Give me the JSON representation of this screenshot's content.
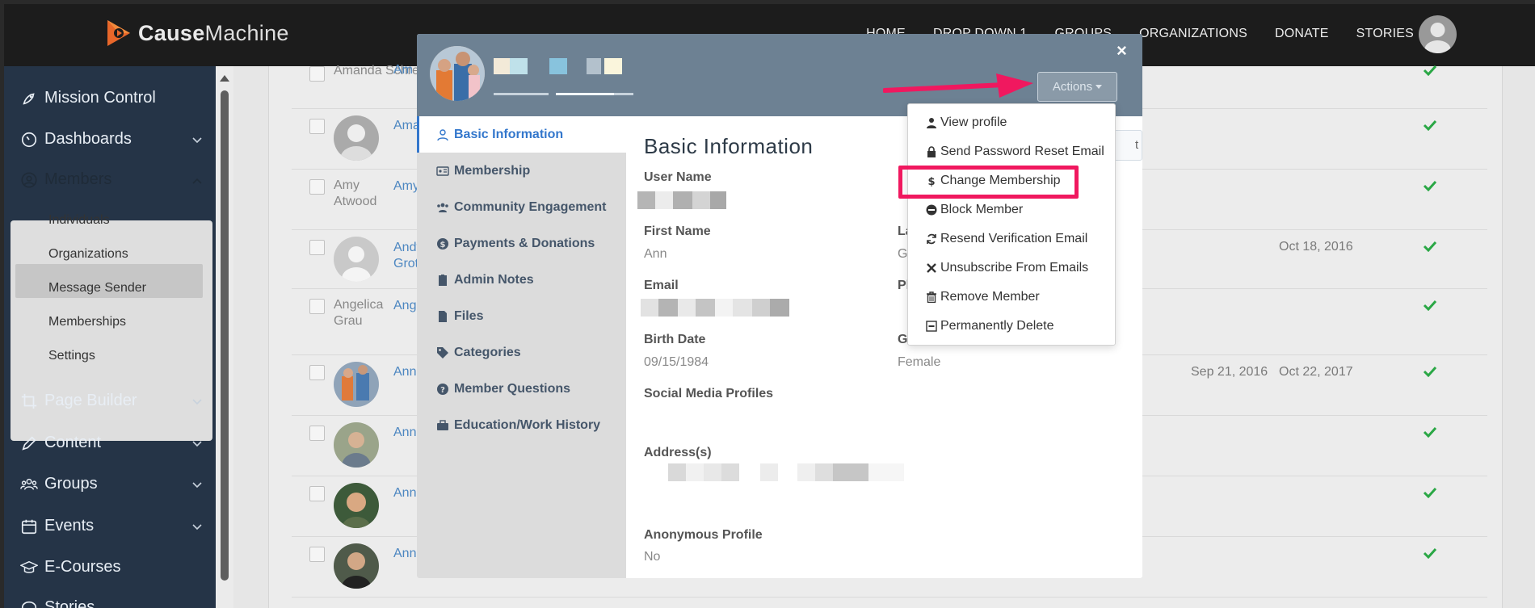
{
  "brand": {
    "name_bold": "Cause",
    "name_rest": "Machine"
  },
  "nav": [
    "HOME",
    "DROP DOWN 1",
    "GROUPS",
    "ORGANIZATIONS",
    "DONATE",
    "STORIES"
  ],
  "sidebar": {
    "items": [
      {
        "label": "Mission Control",
        "icon": "rocket-icon"
      },
      {
        "label": "Dashboards",
        "icon": "gauge-icon"
      },
      {
        "label": "Members",
        "icon": "user-circle-icon"
      },
      {
        "label": "Page Builder",
        "icon": "crop-icon"
      },
      {
        "label": "Content",
        "icon": "pencil-icon"
      },
      {
        "label": "Groups",
        "icon": "users-icon"
      },
      {
        "label": "Events",
        "icon": "calendar-icon"
      },
      {
        "label": "E-Courses",
        "icon": "graduation-cap-icon"
      },
      {
        "label": "Stories",
        "icon": "speech-bubble-icon"
      }
    ],
    "members_sub": [
      "Individuals",
      "Organizations",
      "Message Sender",
      "Memberships",
      "Settings"
    ]
  },
  "table": {
    "rows": [
      {
        "alt": "Amanda Schreir",
        "name": "Am",
        "date1": "",
        "date2": ""
      },
      {
        "alt": "",
        "name": "Ama",
        "date1": "",
        "date2": ""
      },
      {
        "alt": "Amy Atwood",
        "name": "Amy",
        "date1": "",
        "date2": ""
      },
      {
        "alt": "",
        "name": "Andy Grot",
        "date1": "",
        "date2": "Oct 18, 2016"
      },
      {
        "alt": "Angelica Grau",
        "name": "Ang",
        "date1": "",
        "date2": ""
      },
      {
        "alt": "",
        "name": "Ann",
        "date1": "Sep 21, 2016",
        "date2": "Oct 22, 2017"
      },
      {
        "alt": "",
        "name": "Ann",
        "date1": "",
        "date2": ""
      },
      {
        "alt": "",
        "name": "Ann",
        "date1": "",
        "date2": ""
      },
      {
        "alt": "",
        "name": "Ann",
        "date1": "",
        "date2": ""
      }
    ],
    "check_color": "#2aa745"
  },
  "modal": {
    "close": "×",
    "actions_label": "Actions",
    "tabs": [
      {
        "label": "Basic Information",
        "icon": "user-icon"
      },
      {
        "label": "Membership",
        "icon": "id-card-icon"
      },
      {
        "label": "Community Engagement",
        "icon": "users-icon"
      },
      {
        "label": "Payments & Donations",
        "icon": "dollar-circle-icon"
      },
      {
        "label": "Admin Notes",
        "icon": "clipboard-icon"
      },
      {
        "label": "Files",
        "icon": "file-icon"
      },
      {
        "label": "Categories",
        "icon": "tag-icon"
      },
      {
        "label": "Member Questions",
        "icon": "question-circle-icon"
      },
      {
        "label": "Education/Work History",
        "icon": "briefcase-icon"
      }
    ],
    "body": {
      "title": "Basic Information",
      "edit_label": "t",
      "user_name_label": "User Name",
      "first_name_label": "First Name",
      "first_name": "Ann",
      "last_name_label": "La",
      "last_name_partial": "G",
      "email_label": "Email",
      "phone_label_partial": "Ph",
      "birth_date_label": "Birth Date",
      "birth_date": "09/15/1984",
      "gender_label_partial": "G",
      "gender": "Female",
      "social_label": "Social Media Profiles",
      "address_label": "Address(s)",
      "anon_label": "Anonymous Profile",
      "anon_value": "No"
    },
    "dropdown": [
      {
        "label": "View profile",
        "icon": "user-icon"
      },
      {
        "label": "Send Password Reset Email",
        "icon": "lock-icon"
      },
      {
        "label": "Change Membership",
        "icon": "dollar-icon"
      },
      {
        "label": "Block Member",
        "icon": "minus-circle-icon"
      },
      {
        "label": "Resend Verification Email",
        "icon": "refresh-icon"
      },
      {
        "label": "Unsubscribe From Emails",
        "icon": "times-icon"
      },
      {
        "label": "Remove Member",
        "icon": "trash-icon"
      },
      {
        "label": "Permanently Delete",
        "icon": "minus-square-icon"
      }
    ]
  },
  "colors": {
    "highlight": "#f0185f",
    "accent": "#3377cc",
    "sidebar": "#253447",
    "modal_header": "#6d8193"
  }
}
